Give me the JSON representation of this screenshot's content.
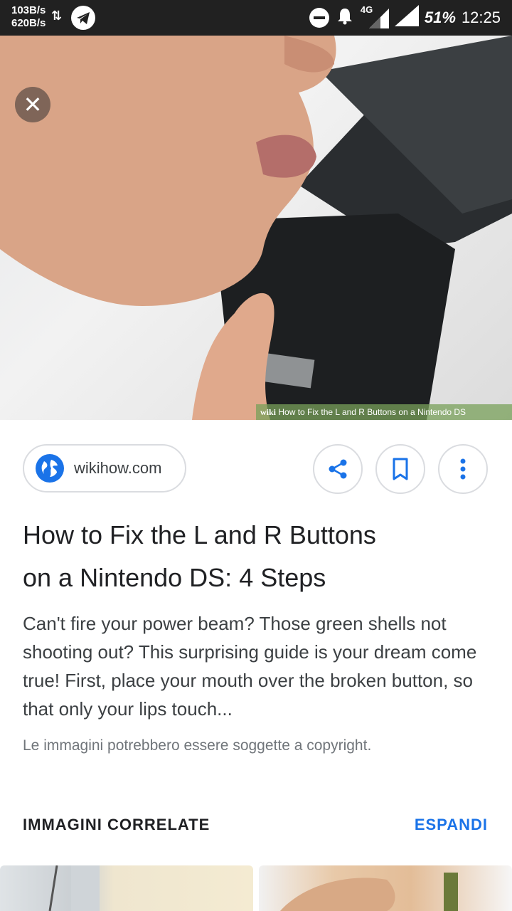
{
  "status_bar": {
    "net_up": "103B/s",
    "net_down": "620B/s",
    "network": "4G",
    "battery": "51%",
    "time": "12:25"
  },
  "hero": {
    "close_icon": "close-icon",
    "watermark_brand": "wiki",
    "watermark_text": "How to Fix the L and R Buttons on a Nintendo DS"
  },
  "source": {
    "site": "wikihow.com",
    "icon": "globe-icon"
  },
  "actions": {
    "share_icon": "share-icon",
    "bookmark_icon": "bookmark-icon",
    "more_icon": "more-vert-icon"
  },
  "result": {
    "title_line1": "How to Fix the L and R Buttons",
    "title_line2": "on a Nintendo DS: 4 Steps",
    "snippet": "Can't fire your power beam? Those green shells not shooting out? This surprising guide is your dream come true! First, place your mouth over the broken button, so that only your lips touch...",
    "copyright": "Le immagini potrebbero essere soggette a copyright."
  },
  "related": {
    "title": "IMMAGINI CORRELATE",
    "expand_label": "ESPANDI"
  },
  "colors": {
    "accent": "#1a73e8",
    "status_bar": "#212121"
  }
}
